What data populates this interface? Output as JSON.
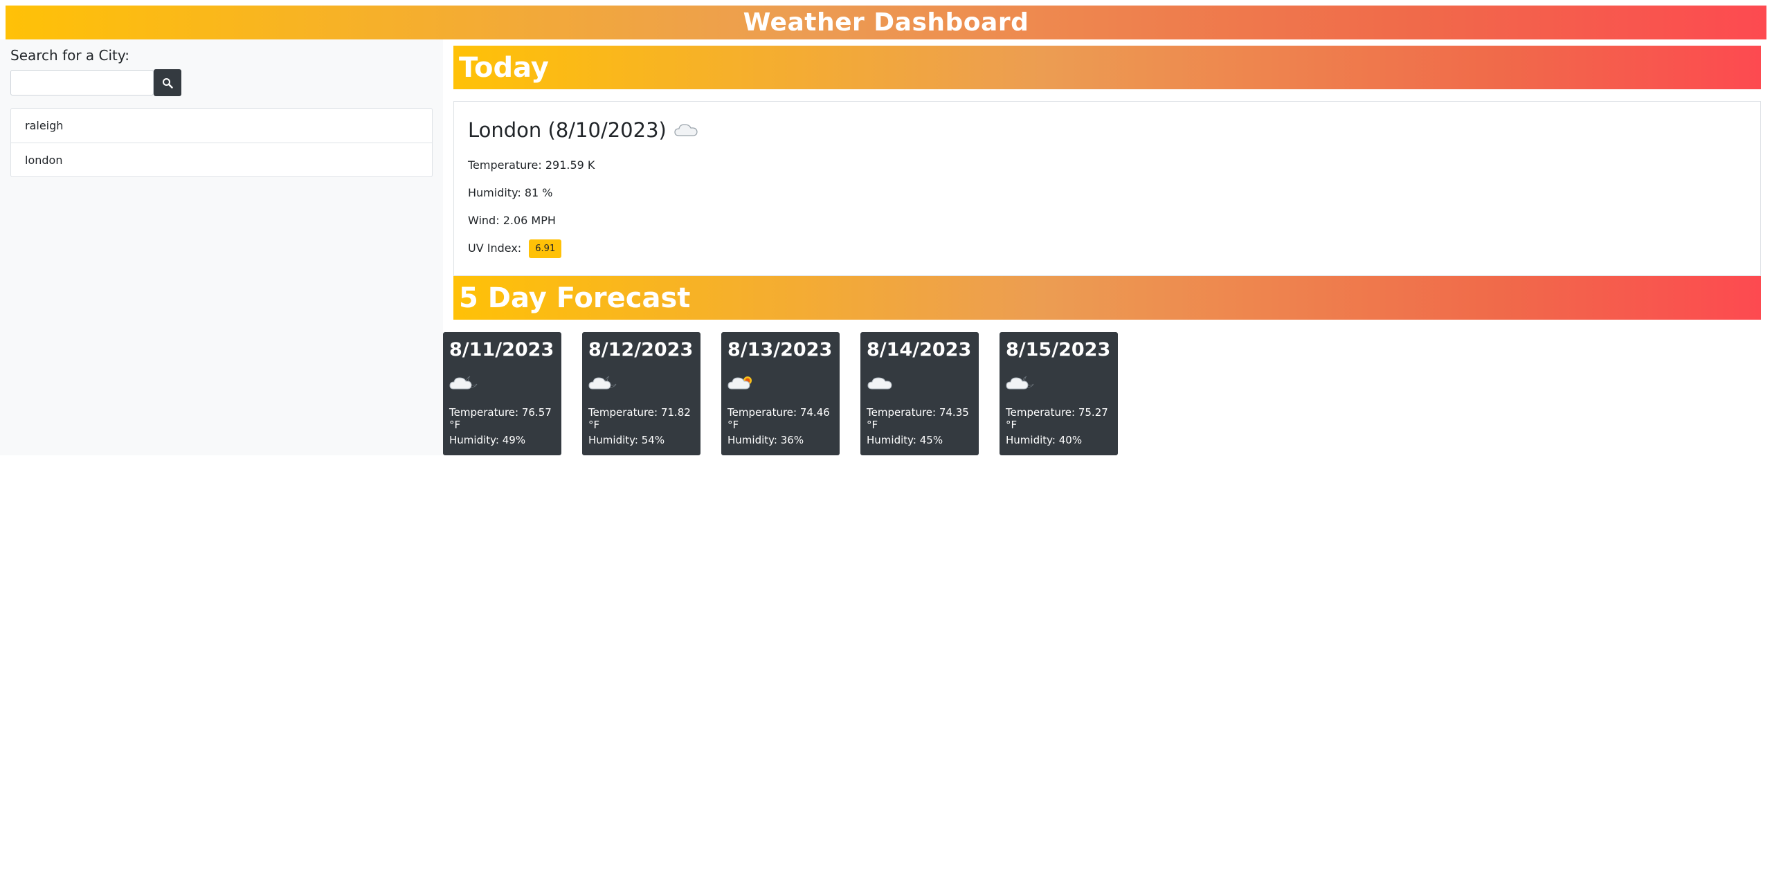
{
  "header": {
    "title": "Weather Dashboard"
  },
  "colors": {
    "gradient_start": "#ffc107",
    "gradient_end": "#fd4a50",
    "card_dark": "#343a40",
    "uv_badge": "#ffc107"
  },
  "search": {
    "label": "Search for a City:",
    "value": "",
    "placeholder": "",
    "button_icon": "search-icon"
  },
  "history": [
    {
      "label": "raleigh"
    },
    {
      "label": "london"
    }
  ],
  "today": {
    "heading": "Today",
    "title": "London (8/10/2023)",
    "icon": "cloud-icon",
    "temperature": "Temperature: 291.59 K",
    "humidity": "Humidity: 81 %",
    "wind": "Wind: 2.06 MPH",
    "uv_label": "UV Index:",
    "uv_value": "6.91"
  },
  "forecast": {
    "heading": "5 Day Forecast",
    "days": [
      {
        "date": "8/11/2023",
        "icon": "cloud-moon-icon",
        "temperature": "Temperature: 76.57 °F",
        "humidity": "Humidity: 49%"
      },
      {
        "date": "8/12/2023",
        "icon": "cloud-moon-icon",
        "temperature": "Temperature: 71.82 °F",
        "humidity": "Humidity: 54%"
      },
      {
        "date": "8/13/2023",
        "icon": "cloud-sun-icon",
        "temperature": "Temperature: 74.46 °F",
        "humidity": "Humidity: 36%"
      },
      {
        "date": "8/14/2023",
        "icon": "cloud-icon",
        "temperature": "Temperature: 74.35 °F",
        "humidity": "Humidity: 45%"
      },
      {
        "date": "8/15/2023",
        "icon": "cloud-moon-icon",
        "temperature": "Temperature: 75.27 °F",
        "humidity": "Humidity: 40%"
      }
    ]
  }
}
